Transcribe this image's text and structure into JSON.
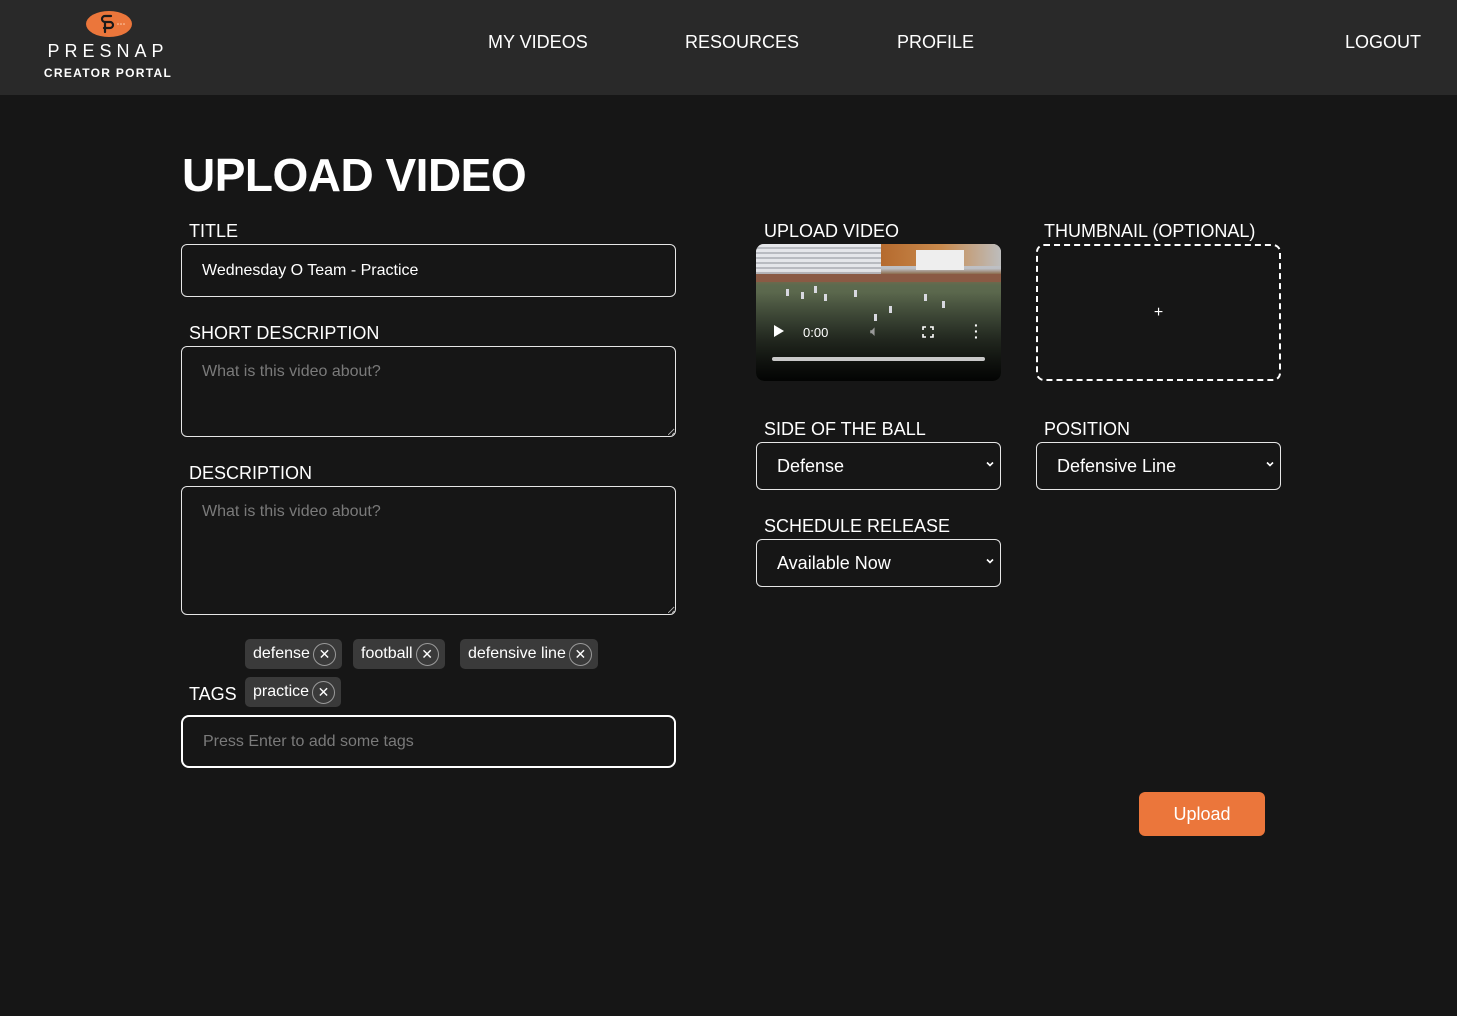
{
  "brand": {
    "name": "PRESNAP",
    "subtitle": "CREATOR PORTAL",
    "logo_icon": "football-icon",
    "accent_color": "#eb763b"
  },
  "nav": {
    "links": [
      {
        "label": "MY VIDEOS"
      },
      {
        "label": "RESOURCES"
      },
      {
        "label": "PROFILE"
      }
    ],
    "logout_label": "LOGOUT"
  },
  "page": {
    "title": "UPLOAD VIDEO"
  },
  "form": {
    "title": {
      "label": "TITLE",
      "value": "Wednesday O Team - Practice"
    },
    "short_description": {
      "label": "SHORT DESCRIPTION",
      "value": "",
      "placeholder": "What is this video about?"
    },
    "description": {
      "label": "DESCRIPTION",
      "value": "",
      "placeholder": "What is this video about?"
    },
    "tags": {
      "label": "TAGS",
      "items": [
        {
          "label": "defense"
        },
        {
          "label": "football"
        },
        {
          "label": "defensive line"
        },
        {
          "label": "practice"
        }
      ],
      "remove_icon": "close-circle-icon",
      "input_value": "",
      "placeholder": "Press Enter to add some tags"
    },
    "upload_video": {
      "label": "UPLOAD VIDEO",
      "player": {
        "current_time": "0:00",
        "play_icon": "play-icon",
        "volume_icon": "volume-icon",
        "fullscreen_icon": "fullscreen-icon",
        "more_icon": "more-vertical-icon"
      }
    },
    "thumbnail": {
      "label": "THUMBNAIL (OPTIONAL)",
      "add_symbol": "+"
    },
    "side_of_ball": {
      "label": "SIDE OF THE BALL",
      "selected": "Defense"
    },
    "position": {
      "label": "POSITION",
      "selected": "Defensive Line"
    },
    "schedule_release": {
      "label": "SCHEDULE RELEASE",
      "selected": "Available Now"
    },
    "submit_label": "Upload"
  }
}
